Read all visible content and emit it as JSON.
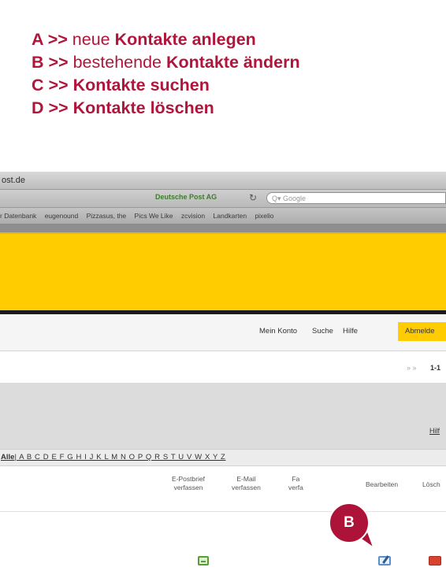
{
  "instructions": [
    {
      "letter": "A >>",
      "plain": " neue ",
      "bold": "Kontakte anlegen"
    },
    {
      "letter": "B >>",
      "plain": " bestehende ",
      "bold": "Kontakte ändern"
    },
    {
      "letter": "C >>",
      "plain": " ",
      "bold": "Kontakte suchen"
    },
    {
      "letter": "D >>",
      "plain": " ",
      "bold": "Kontakte löschen"
    }
  ],
  "browser": {
    "title": "ost.de",
    "address_site_label": "Deutsche Post AG",
    "search_placeholder": "Q▾ Google",
    "bookmarks": [
      "r Datenbank",
      "eugenound",
      "Pizzasus, the",
      "Pics We Like",
      "zcvision",
      "Landkarten",
      "pixelio"
    ]
  },
  "topnav": {
    "account": "Mein Konto",
    "search": "Suche",
    "help": "Hilfe",
    "logout": "Abmelde"
  },
  "pager": {
    "arrows": "» »",
    "range": "1-1"
  },
  "help_link": "Hilf",
  "alphabet": {
    "all": "Alle",
    "letters": "| A B C D E F G H I J K L M N O P Q R S T U V W X Y Z"
  },
  "actions": [
    {
      "line1": "E-Postbrief",
      "line2": "verfassen"
    },
    {
      "line1": "E-Mail",
      "line2": "verfassen"
    },
    {
      "line1": "Fa",
      "line2": "verfa"
    },
    {
      "line1": "Bearbeiten",
      "line2": ""
    },
    {
      "line1": "Lösch",
      "line2": ""
    }
  ],
  "callout": "B",
  "colors": {
    "accent": "#ad1339",
    "brand_yellow": "#ffcc00"
  }
}
